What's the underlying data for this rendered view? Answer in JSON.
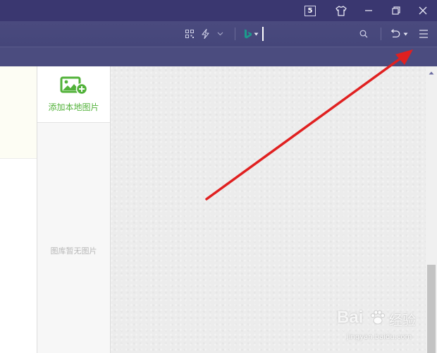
{
  "titlebar": {
    "badge_number": "5",
    "buttons": [
      "skin-icon",
      "minimize-icon",
      "restore-icon",
      "close-icon"
    ]
  },
  "toolbar": {
    "icons": [
      "qr-code-icon",
      "lightning-icon",
      "chevron-down-icon",
      "bing-search-icon",
      "search-icon",
      "undo-icon",
      "menu-icon"
    ]
  },
  "image_panel": {
    "add_label": "添加本地图片",
    "empty_text": "图库暂无图片"
  },
  "watermark": {
    "brand": "Bai",
    "brand_suffix": "经验",
    "url": "jingyan.baidu.com"
  },
  "colors": {
    "titlebar": "#3a3770",
    "toolbar": "#4a4a7e",
    "accent_green": "#52b23a",
    "arrow_red": "#e02020"
  }
}
